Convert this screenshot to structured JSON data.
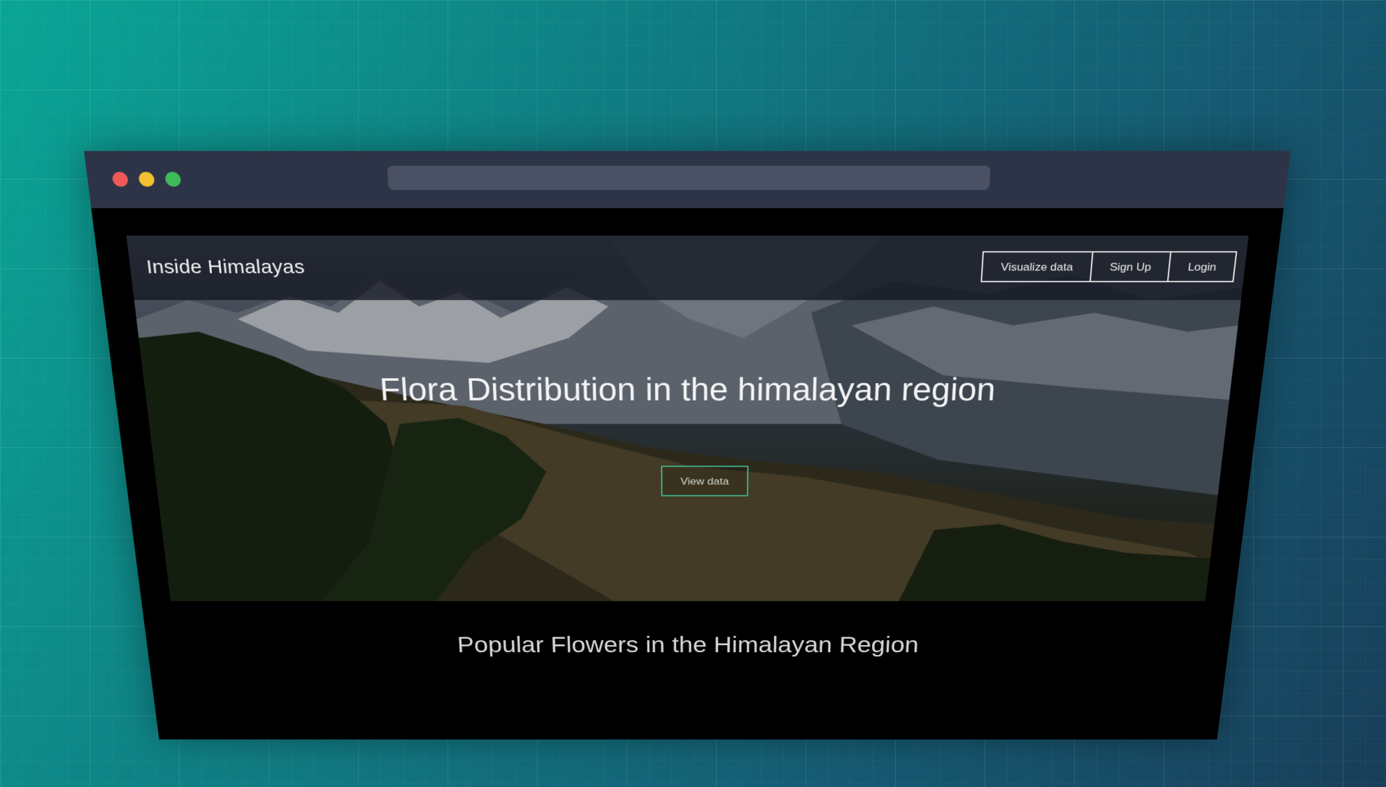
{
  "site": {
    "brand": "Inside Himalayas",
    "nav": [
      {
        "label": "Visualize data"
      },
      {
        "label": "Sign Up"
      },
      {
        "label": "Login"
      }
    ]
  },
  "hero": {
    "title": "Flora Distribution in the himalayan region",
    "cta_label": "View data"
  },
  "section": {
    "title": "Popular Flowers in the Himalayan Region"
  },
  "colors": {
    "cta_border": "#3fb58f",
    "titlebar": "#2e3447",
    "close_dot": "#ee5a5a",
    "minimize_dot": "#f2c230",
    "maximize_dot": "#3fbb5a"
  }
}
